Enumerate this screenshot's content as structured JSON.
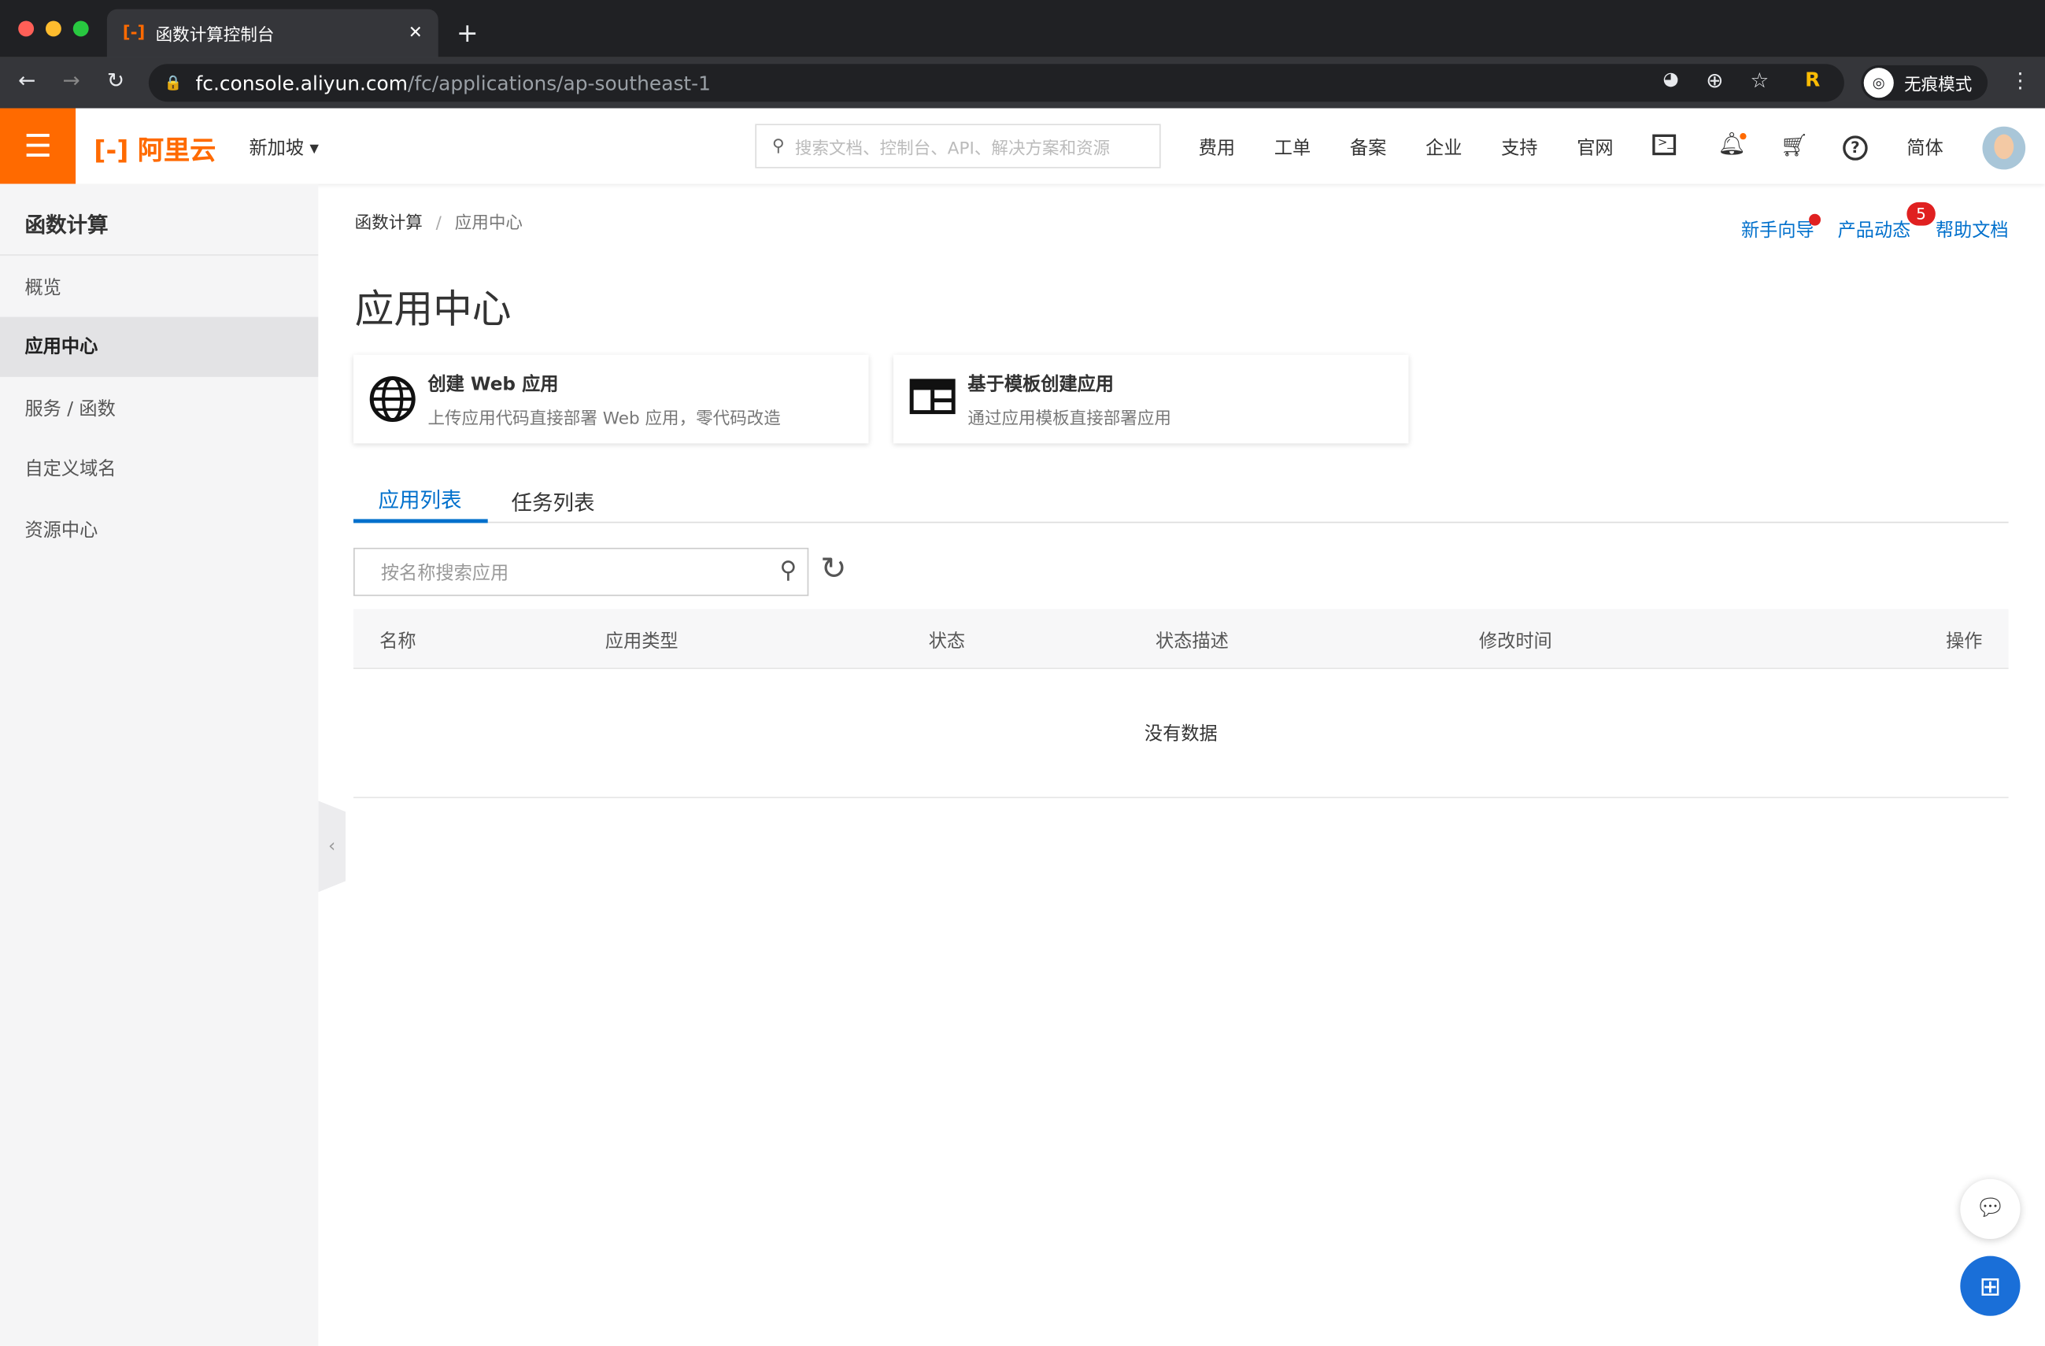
{
  "browser": {
    "tab_title": "函数计算控制台",
    "url_host": "fc.console.aliyun.com",
    "url_path": "/fc/applications/ap-southeast-1",
    "incognito_label": "无痕模式"
  },
  "header": {
    "logo": "阿里云",
    "region": "新加坡",
    "search_placeholder": "搜索文档、控制台、API、解决方案和资源",
    "nav": [
      "费用",
      "工单",
      "备案",
      "企业",
      "支持",
      "官网"
    ],
    "language": "简体",
    "accent": "#ff6a00"
  },
  "sidebar": {
    "title": "函数计算",
    "items": [
      {
        "label": "概览"
      },
      {
        "label": "应用中心",
        "active": true
      },
      {
        "label": "服务 / 函数"
      },
      {
        "label": "自定义域名"
      },
      {
        "label": "资源中心"
      }
    ]
  },
  "main": {
    "breadcrumb": [
      "函数计算",
      "应用中心"
    ],
    "top_links": {
      "guide": "新手向导",
      "news": "产品动态",
      "news_badge": "5",
      "docs": "帮助文档"
    },
    "title": "应用中心",
    "cards": [
      {
        "title": "创建 Web 应用",
        "desc": "上传应用代码直接部署 Web 应用，零代码改造",
        "icon": "globe-icon"
      },
      {
        "title": "基于模板创建应用",
        "desc": "通过应用模板直接部署应用",
        "icon": "template-icon"
      }
    ],
    "tabs": [
      {
        "label": "应用列表",
        "active": true
      },
      {
        "label": "任务列表"
      }
    ],
    "search_placeholder": "按名称搜索应用",
    "table": {
      "columns": [
        "名称",
        "应用类型",
        "状态",
        "状态描述",
        "修改时间",
        "操作"
      ],
      "empty_text": "没有数据"
    }
  }
}
